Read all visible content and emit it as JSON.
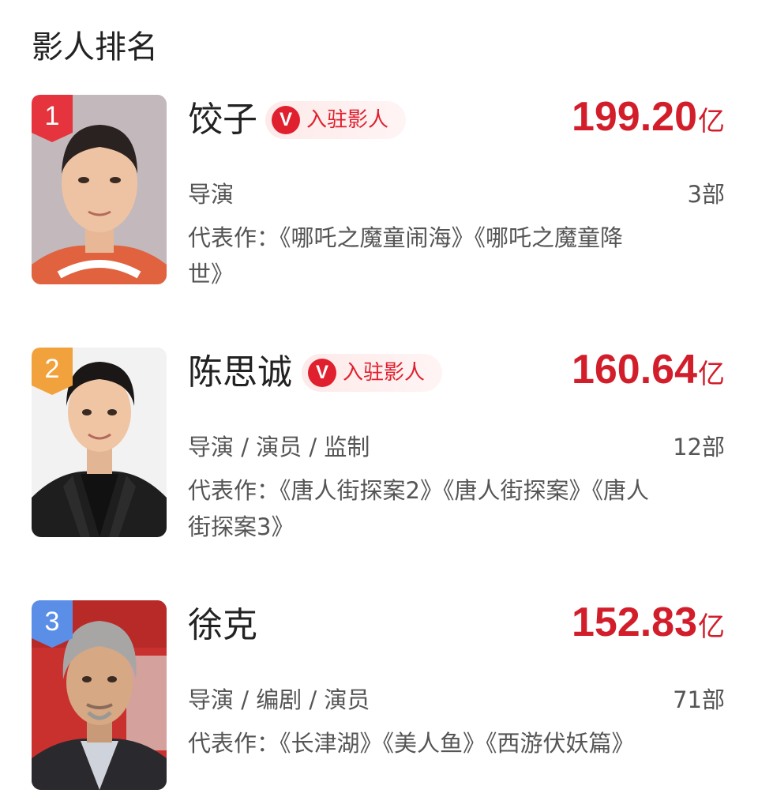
{
  "section": {
    "title": "影人排名"
  },
  "colors": {
    "accent_red": "#d21e2b",
    "rank1": "#e5343d",
    "rank2": "#f2a23c",
    "rank3": "#5b8ee6"
  },
  "people": [
    {
      "rank": "1",
      "name": "饺子",
      "verified": true,
      "verified_icon": "V",
      "verified_label": "入驻影人",
      "box_office": "199.20",
      "box_office_unit": "亿",
      "roles": "导演",
      "works_count": "3部",
      "representative_works": "代表作：《哪吒之魔童闹海》《哪吒之魔童降世》"
    },
    {
      "rank": "2",
      "name": "陈思诚",
      "verified": true,
      "verified_icon": "V",
      "verified_label": "入驻影人",
      "box_office": "160.64",
      "box_office_unit": "亿",
      "roles": "导演 / 演员 / 监制",
      "works_count": "12部",
      "representative_works": "代表作：《唐人街探案2》《唐人街探案》《唐人街探案3》"
    },
    {
      "rank": "3",
      "name": "徐克",
      "verified": false,
      "box_office": "152.83",
      "box_office_unit": "亿",
      "roles": "导演 / 编剧 / 演员",
      "works_count": "71部",
      "representative_works": "代表作：《长津湖》《美人鱼》《西游伏妖篇》"
    }
  ]
}
